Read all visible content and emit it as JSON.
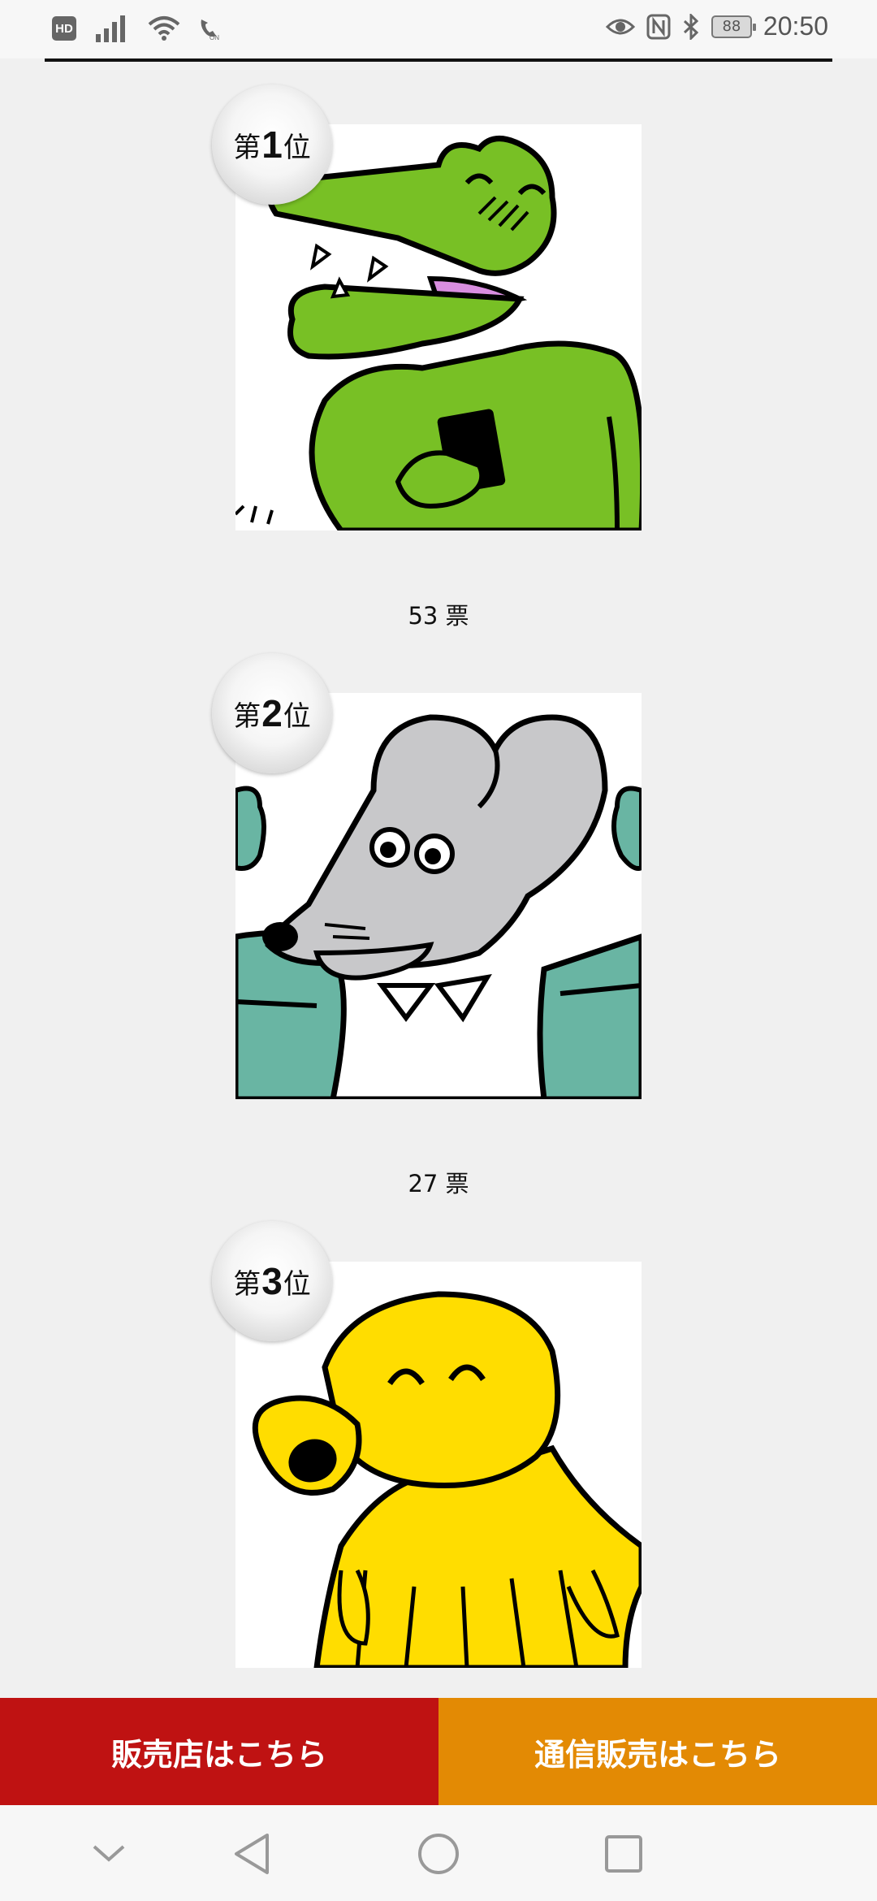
{
  "status_bar": {
    "hd_label": "HD",
    "battery": "88",
    "time": "20:50",
    "icons": [
      "signal-icon",
      "wifi-icon",
      "wifi-calling-icon",
      "eye-comfort-icon",
      "nfc-icon",
      "bluetooth-icon"
    ]
  },
  "ranking": [
    {
      "prefix": "第",
      "rank": "1",
      "suffix": "位",
      "votes": "53 票",
      "character": "green-crocodile"
    },
    {
      "prefix": "第",
      "rank": "2",
      "suffix": "位",
      "votes": "27 票",
      "character": "gray-mouse"
    },
    {
      "prefix": "第",
      "rank": "3",
      "suffix": "位",
      "character": "yellow-octopus"
    }
  ],
  "cta": {
    "stores_label": "販売店はこちら",
    "mail_order_label": "通信販売はこちら",
    "stores_color": "#bf1212",
    "mail_order_color": "#e38a04"
  },
  "nav": [
    "chevron-down-icon",
    "back-icon",
    "home-icon",
    "recents-icon"
  ]
}
